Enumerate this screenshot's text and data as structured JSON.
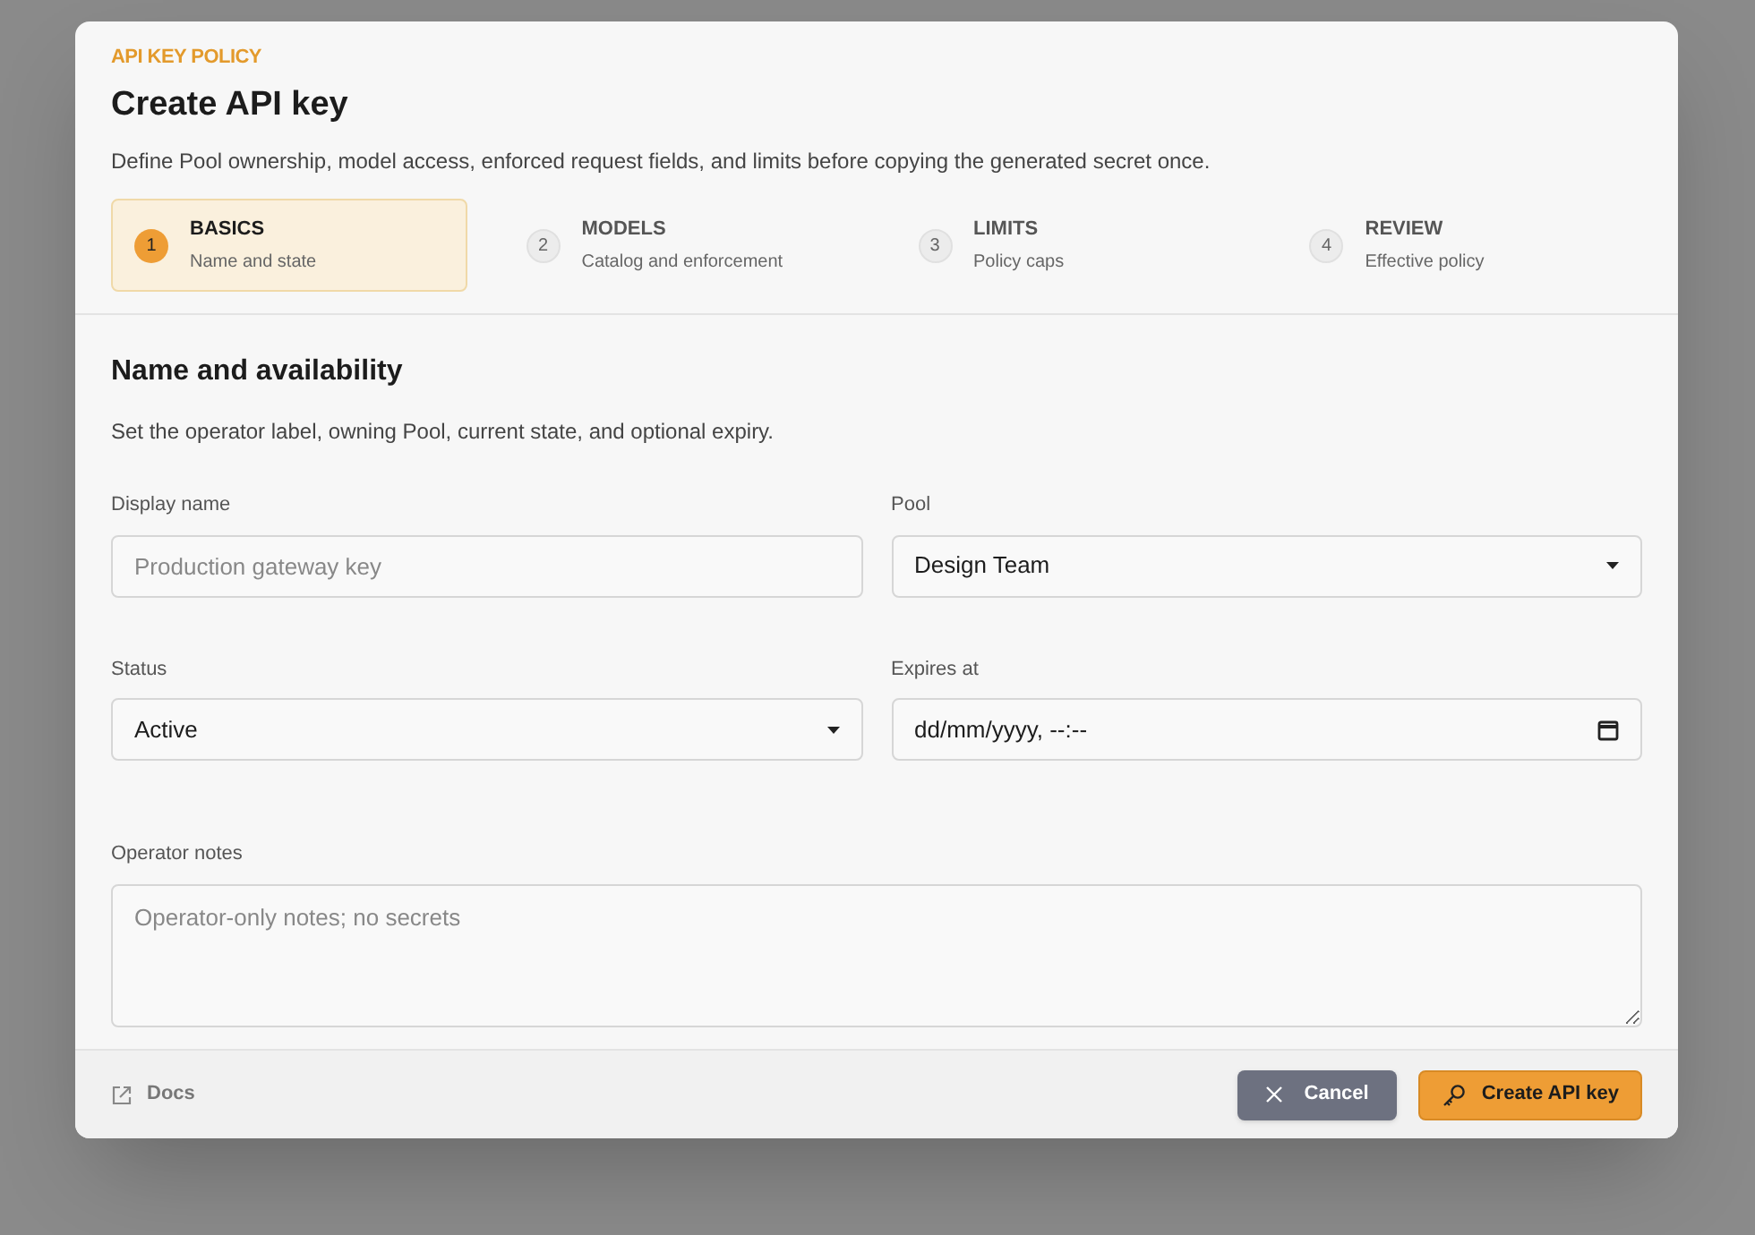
{
  "dialog": {
    "eyebrow": "API KEY POLICY",
    "title": "Create API key",
    "description": "Define Pool ownership, model access, enforced request fields, and limits before copying the generated secret once."
  },
  "steps": [
    {
      "number": "1",
      "label": "BASICS",
      "sublabel": "Name and state",
      "selected": true
    },
    {
      "number": "2",
      "label": "MODELS",
      "sublabel": "Catalog and enforcement",
      "selected": false
    },
    {
      "number": "3",
      "label": "LIMITS",
      "sublabel": "Policy caps",
      "selected": false
    },
    {
      "number": "4",
      "label": "REVIEW",
      "sublabel": "Effective policy",
      "selected": false
    }
  ],
  "section": {
    "title": "Name and availability",
    "description": "Set the operator label, owning Pool, current state, and optional expiry."
  },
  "fields": [
    {
      "kind": "text",
      "label": "Display name",
      "placeholder": "Production gateway key"
    },
    {
      "kind": "select",
      "label": "Pool",
      "value": "Design Team"
    },
    {
      "kind": "select",
      "label": "Status",
      "value": "Active"
    },
    {
      "kind": "datetime",
      "label": "Expires at",
      "value": "dd/mm/yyyy, --:--"
    },
    {
      "kind": "textarea",
      "label": "Operator notes",
      "placeholder": "Operator-only notes; no secrets"
    }
  ],
  "footer": {
    "docs_link": "Docs",
    "cancel_button": "Cancel",
    "create_button": "Create API key"
  }
}
